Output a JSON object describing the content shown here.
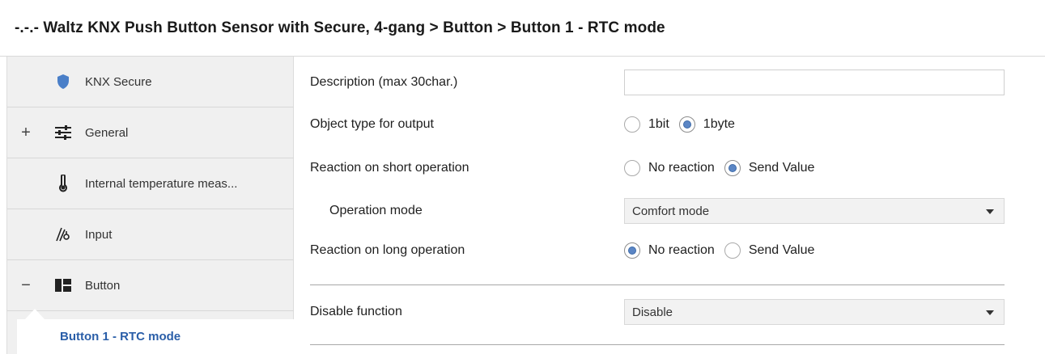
{
  "title": "-.-.- Waltz KNX Push Button Sensor with Secure, 4-gang > Button > Button 1 - RTC mode",
  "sidebar": {
    "items": [
      {
        "label": "KNX Secure",
        "expander": "",
        "icon": "shield-icon"
      },
      {
        "label": "General",
        "expander": "+",
        "icon": "sliders-icon"
      },
      {
        "label": "Internal temperature meas...",
        "expander": "",
        "icon": "thermometer-icon"
      },
      {
        "label": "Input",
        "expander": "",
        "icon": "input-icon"
      },
      {
        "label": "Button",
        "expander": "−",
        "icon": "button-icon"
      }
    ],
    "child": {
      "label": "Button 1 - RTC mode"
    }
  },
  "params": {
    "description": {
      "label": "Description (max 30char.)",
      "value": ""
    },
    "object_type": {
      "label": "Object type for output",
      "options": [
        "1bit",
        "1byte"
      ],
      "selected": "1byte"
    },
    "short_operation": {
      "label": "Reaction on short operation",
      "options": [
        "No reaction",
        "Send Value"
      ],
      "selected": "Send Value"
    },
    "operation_mode": {
      "label": "Operation mode",
      "value": "Comfort mode"
    },
    "long_operation": {
      "label": "Reaction on long operation",
      "options": [
        "No reaction",
        "Send Value"
      ],
      "selected": "No reaction"
    },
    "disable_function": {
      "label": "Disable function",
      "value": "Disable"
    }
  },
  "colors": {
    "accent": "#2a5ea8",
    "shield": "#4a7fc8",
    "radio_fill": "#5b86c5"
  }
}
